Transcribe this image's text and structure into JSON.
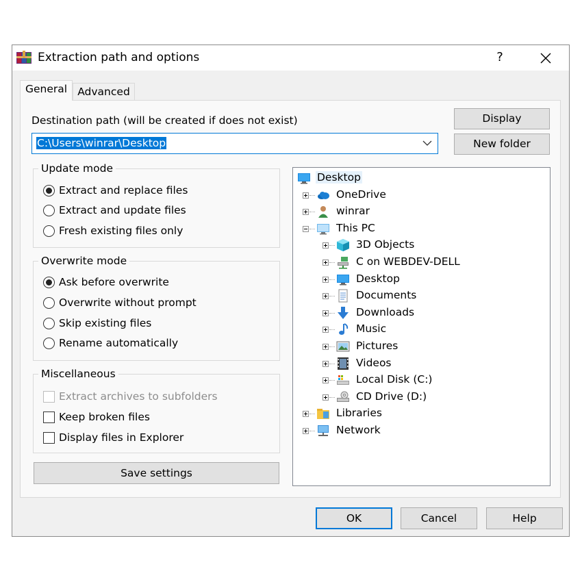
{
  "window": {
    "title": "Extraction path and options",
    "help_label": "?"
  },
  "tabs": [
    {
      "label": "General",
      "selected": true
    },
    {
      "label": "Advanced",
      "selected": false
    }
  ],
  "destination": {
    "label": "Destination path (will be created if does not exist)",
    "value": "C:\\Users\\winrar\\Desktop"
  },
  "buttons": {
    "display": "Display",
    "new_folder": "New folder",
    "save_settings": "Save settings",
    "ok": "OK",
    "cancel": "Cancel",
    "help": "Help"
  },
  "update_mode": {
    "title": "Update mode",
    "options": [
      {
        "label": "Extract and replace files",
        "checked": true
      },
      {
        "label": "Extract and update files",
        "checked": false
      },
      {
        "label": "Fresh existing files only",
        "checked": false
      }
    ]
  },
  "overwrite_mode": {
    "title": "Overwrite mode",
    "options": [
      {
        "label": "Ask before overwrite",
        "checked": true
      },
      {
        "label": "Overwrite without prompt",
        "checked": false
      },
      {
        "label": "Skip existing files",
        "checked": false
      },
      {
        "label": "Rename automatically",
        "checked": false
      }
    ]
  },
  "misc": {
    "title": "Miscellaneous",
    "options": [
      {
        "label": "Extract archives to subfolders",
        "checked": false,
        "enabled": false
      },
      {
        "label": "Keep broken files",
        "checked": false,
        "enabled": true
      },
      {
        "label": "Display files in Explorer",
        "checked": false,
        "enabled": true
      }
    ]
  },
  "tree": {
    "items": [
      {
        "label": "Desktop",
        "icon": "desktop-icon",
        "level": 0,
        "selected": true
      },
      {
        "label": "OneDrive",
        "icon": "onedrive-icon",
        "level": 1,
        "expander": "plus"
      },
      {
        "label": "winrar",
        "icon": "user-icon",
        "level": 1,
        "expander": "plus"
      },
      {
        "label": "This PC",
        "icon": "computer-icon",
        "level": 1,
        "expander": "minus"
      },
      {
        "label": "3D Objects",
        "icon": "3d-objects-icon",
        "level": 2,
        "expander": "plus"
      },
      {
        "label": "C on WEBDEV-DELL",
        "icon": "network-drive-icon",
        "level": 2,
        "expander": "plus"
      },
      {
        "label": "Desktop",
        "icon": "desktop-icon",
        "level": 2,
        "expander": "plus"
      },
      {
        "label": "Documents",
        "icon": "documents-icon",
        "level": 2,
        "expander": "plus"
      },
      {
        "label": "Downloads",
        "icon": "downloads-icon",
        "level": 2,
        "expander": "plus"
      },
      {
        "label": "Music",
        "icon": "music-icon",
        "level": 2,
        "expander": "plus"
      },
      {
        "label": "Pictures",
        "icon": "pictures-icon",
        "level": 2,
        "expander": "plus"
      },
      {
        "label": "Videos",
        "icon": "videos-icon",
        "level": 2,
        "expander": "plus"
      },
      {
        "label": "Local Disk (C:)",
        "icon": "local-disk-icon",
        "level": 2,
        "expander": "plus"
      },
      {
        "label": "CD Drive (D:)",
        "icon": "cd-drive-icon",
        "level": 2,
        "expander": "plus"
      },
      {
        "label": "Libraries",
        "icon": "libraries-icon",
        "level": 1,
        "expander": "plus"
      },
      {
        "label": "Network",
        "icon": "network-icon",
        "level": 1,
        "expander": "plus"
      }
    ]
  },
  "colors": {
    "accent": "#0078d7",
    "selection": "#0078d7",
    "ok_border": "#0078d7"
  }
}
